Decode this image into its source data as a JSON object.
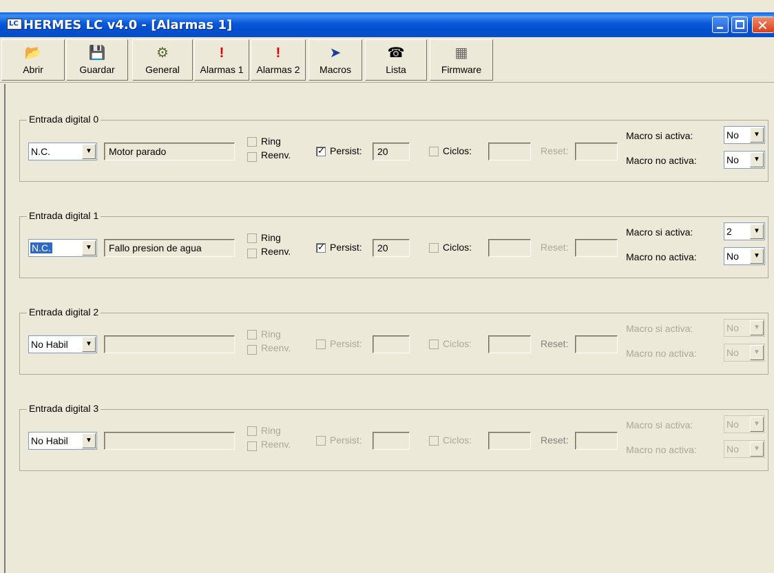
{
  "window": {
    "title": "HERMES LC v4.0 - [Alarmas 1]",
    "app_icon": "LC"
  },
  "toolbar": [
    {
      "label": "Abrir",
      "icon": "📂"
    },
    {
      "label": "Guardar",
      "icon": "💾"
    },
    {
      "label": "General",
      "icon": "⚙"
    },
    {
      "label": "Alarmas 1",
      "icon": "!"
    },
    {
      "label": "Alarmas 2",
      "icon": "!"
    },
    {
      "label": "Macros",
      "icon": "➤"
    },
    {
      "label": "Lista",
      "icon": "☎"
    },
    {
      "label": "Firmware",
      "icon": "▦"
    }
  ],
  "labels": {
    "ring": "Ring",
    "reenv": "Reenv.",
    "persist": "Persist:",
    "ciclos": "Ciclos:",
    "reset": "Reset:",
    "macro_si": "Macro si activa:",
    "macro_no": "Macro no activa:"
  },
  "inputs": [
    {
      "title": "Entrada digital 0",
      "mode": "N.C.",
      "name": "Motor parado",
      "persist_checked": true,
      "persist": "20",
      "macro_si": "No",
      "macro_no": "No",
      "enabled": true
    },
    {
      "title": "Entrada digital 1",
      "mode": "N.C.",
      "name": "Fallo presion de agua",
      "persist_checked": true,
      "persist": "20",
      "macro_si": "2",
      "macro_no": "No",
      "enabled": true
    },
    {
      "title": "Entrada digital 2",
      "mode": "No Habil",
      "name": "",
      "persist_checked": false,
      "persist": "",
      "macro_si": "No",
      "macro_no": "No",
      "enabled": false
    },
    {
      "title": "Entrada digital 3",
      "mode": "No Habil",
      "name": "",
      "persist_checked": false,
      "persist": "",
      "macro_si": "No",
      "macro_no": "No",
      "enabled": false
    }
  ]
}
